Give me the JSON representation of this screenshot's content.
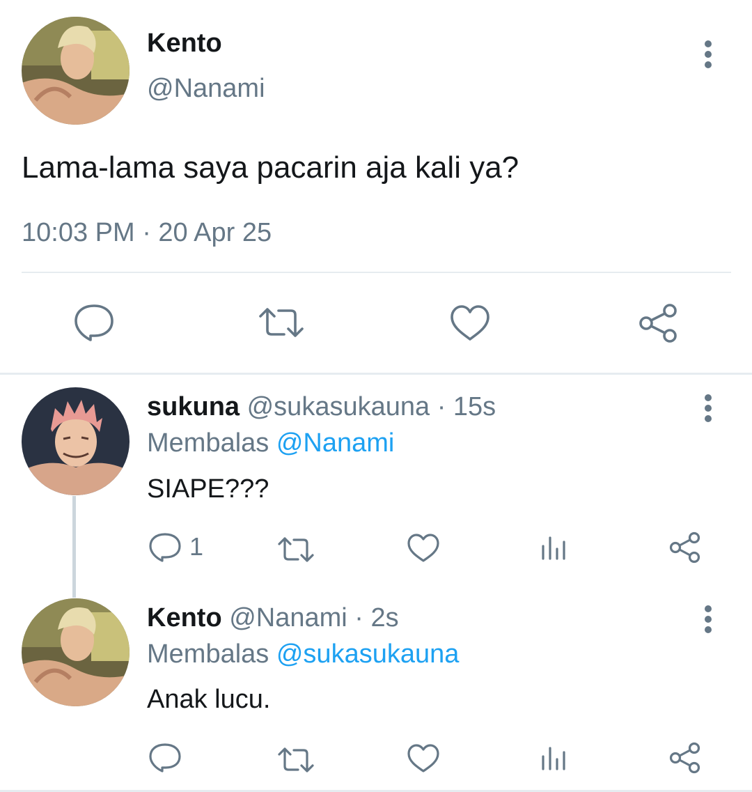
{
  "main_tweet": {
    "display_name": "Kento",
    "handle": "@Nanami",
    "text": "Lama-lama saya pacarin aja kali ya?",
    "timestamp": "10:03 PM · 20 Apr 25",
    "actions": [
      "reply-icon",
      "retweet-icon",
      "like-icon",
      "share-icon"
    ]
  },
  "replies": [
    {
      "display_name": "sukuna",
      "handle": "@sukasukauna",
      "separator": "·",
      "time": "15s",
      "replying_prefix": "Membalas",
      "replying_to": "@Nanami",
      "text": "SIAPE???",
      "reply_count": "1"
    },
    {
      "display_name": "Kento",
      "handle": "@Nanami",
      "separator": "·",
      "time": "2s",
      "replying_prefix": "Membalas",
      "replying_to": "@sukasukauna",
      "text": "Anak lucu.",
      "reply_count": ""
    }
  ],
  "colors": {
    "text": "#14171a",
    "secondary": "#657786",
    "accent": "#1da1f2",
    "divider": "#e6ecf0"
  }
}
